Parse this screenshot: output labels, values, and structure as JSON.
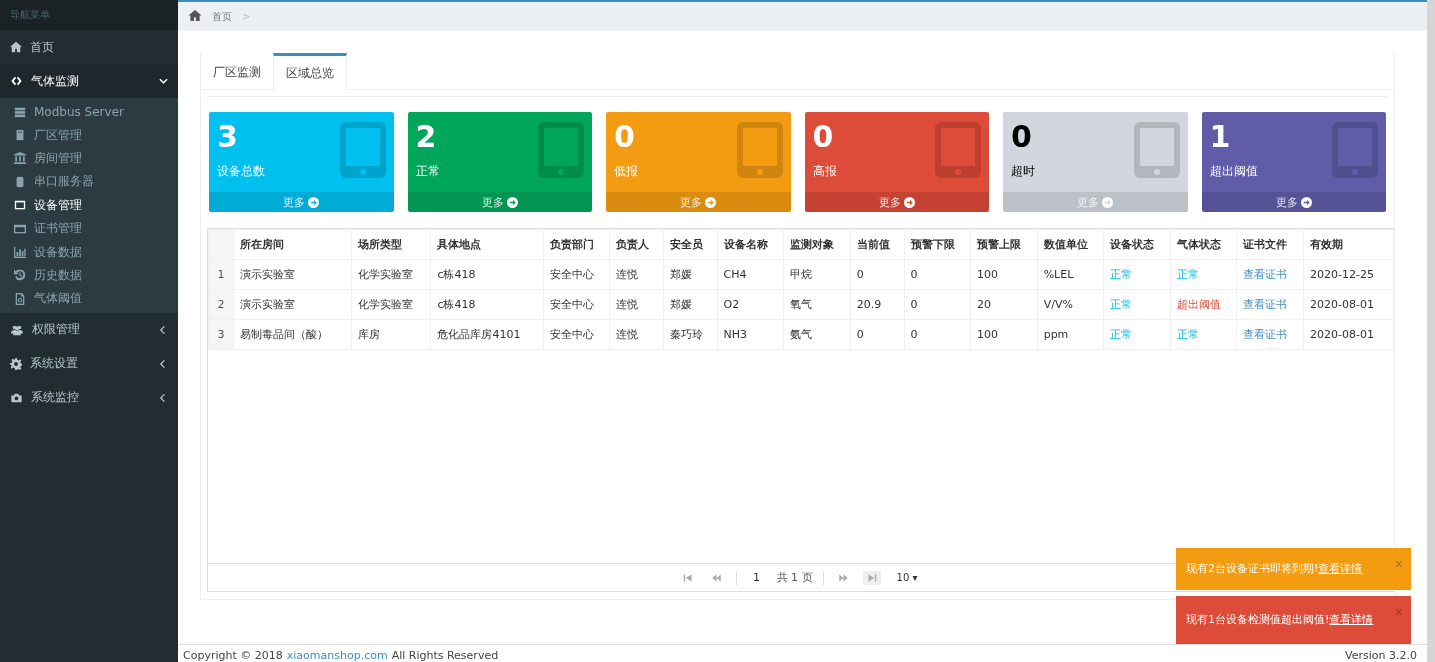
{
  "sidebar": {
    "header": "导航菜单",
    "items": [
      {
        "label": "首页"
      },
      {
        "label": "气体监测",
        "expanded": true,
        "children": [
          {
            "label": "Modbus Server",
            "selected": false
          },
          {
            "label": "厂区管理",
            "selected": false
          },
          {
            "label": "房间管理",
            "selected": false
          },
          {
            "label": "串口服务器",
            "selected": false
          },
          {
            "label": "设备管理",
            "selected": true
          },
          {
            "label": "证书管理",
            "selected": false
          },
          {
            "label": "设备数据",
            "selected": false
          },
          {
            "label": "历史数据",
            "selected": false
          },
          {
            "label": "气体阈值",
            "selected": false
          }
        ]
      },
      {
        "label": "权限管理",
        "expanded": false
      },
      {
        "label": "系统设置",
        "expanded": false
      },
      {
        "label": "系统监控",
        "expanded": false
      }
    ]
  },
  "breadcrumb": {
    "items": [
      "首页"
    ],
    "separator": ">"
  },
  "tabs": [
    {
      "label": "厂区监测",
      "selected": false
    },
    {
      "label": "区域总览",
      "selected": true
    }
  ],
  "cards": [
    {
      "count": "3",
      "label": "设备总数",
      "more": "更多",
      "color": "#00c0ef"
    },
    {
      "count": "2",
      "label": "正常",
      "more": "更多",
      "color": "#00a65a"
    },
    {
      "count": "0",
      "label": "低报",
      "more": "更多",
      "color": "#f39c12"
    },
    {
      "count": "0",
      "label": "高报",
      "more": "更多",
      "color": "#dd4b39"
    },
    {
      "count": "0",
      "label": "超时",
      "more": "更多",
      "color": "#d2d6de"
    },
    {
      "count": "1",
      "label": "超出阈值",
      "more": "更多",
      "color": "#605ca8"
    }
  ],
  "table": {
    "columns": [
      "所在房间",
      "场所类型",
      "具体地点",
      "负责部门",
      "负责人",
      "安全员",
      "设备名称",
      "监测对象",
      "当前值",
      "预警下限",
      "预警上限",
      "数值单位",
      "设备状态",
      "气体状态",
      "证书文件",
      "有效期"
    ],
    "rows": [
      {
        "index": "1",
        "cells": [
          {
            "text": "演示实验室",
            "kind": "text"
          },
          {
            "text": "化学实验室",
            "kind": "text"
          },
          {
            "text": "c栋418",
            "kind": "text"
          },
          {
            "text": "安全中心",
            "kind": "text"
          },
          {
            "text": "连悦",
            "kind": "text"
          },
          {
            "text": "郑媛",
            "kind": "text"
          },
          {
            "text": "CH4",
            "kind": "text"
          },
          {
            "text": "甲烷",
            "kind": "text"
          },
          {
            "text": "0",
            "kind": "text"
          },
          {
            "text": "0",
            "kind": "text"
          },
          {
            "text": "100",
            "kind": "text"
          },
          {
            "text": "%LEL",
            "kind": "text"
          },
          {
            "text": "正常",
            "kind": "ok"
          },
          {
            "text": "正常",
            "kind": "ok"
          },
          {
            "text": "查看证书",
            "kind": "link"
          },
          {
            "text": "2020-12-25",
            "kind": "text"
          }
        ]
      },
      {
        "index": "2",
        "cells": [
          {
            "text": "演示实验室",
            "kind": "text"
          },
          {
            "text": "化学实验室",
            "kind": "text"
          },
          {
            "text": "c栋418",
            "kind": "text"
          },
          {
            "text": "安全中心",
            "kind": "text"
          },
          {
            "text": "连悦",
            "kind": "text"
          },
          {
            "text": "郑媛",
            "kind": "text"
          },
          {
            "text": "O2",
            "kind": "text"
          },
          {
            "text": "氧气",
            "kind": "text"
          },
          {
            "text": "20.9",
            "kind": "text"
          },
          {
            "text": "0",
            "kind": "text"
          },
          {
            "text": "20",
            "kind": "text"
          },
          {
            "text": "V/V%",
            "kind": "text"
          },
          {
            "text": "正常",
            "kind": "ok"
          },
          {
            "text": "超出阈值",
            "kind": "alarm"
          },
          {
            "text": "查看证书",
            "kind": "link"
          },
          {
            "text": "2020-08-01",
            "kind": "text"
          }
        ]
      },
      {
        "index": "3",
        "cells": [
          {
            "text": "易制毒品间（酸）",
            "kind": "text"
          },
          {
            "text": "库房",
            "kind": "text"
          },
          {
            "text": "危化品库房4101",
            "kind": "text"
          },
          {
            "text": "安全中心",
            "kind": "text"
          },
          {
            "text": "连悦",
            "kind": "text"
          },
          {
            "text": "秦巧玲",
            "kind": "text"
          },
          {
            "text": "NH3",
            "kind": "text"
          },
          {
            "text": "氨气",
            "kind": "text"
          },
          {
            "text": "0",
            "kind": "text"
          },
          {
            "text": "0",
            "kind": "text"
          },
          {
            "text": "100",
            "kind": "text"
          },
          {
            "text": "ppm",
            "kind": "text"
          },
          {
            "text": "正常",
            "kind": "ok"
          },
          {
            "text": "正常",
            "kind": "ok"
          },
          {
            "text": "查看证书",
            "kind": "link"
          },
          {
            "text": "2020-08-01",
            "kind": "text"
          }
        ]
      }
    ]
  },
  "pager": {
    "page": "1",
    "total": "共 1 页",
    "page_size": "10 ▾"
  },
  "toasts": [
    {
      "kind": "warning",
      "text": "现有2台设备证书即将到期!",
      "link": "查看详情",
      "close": "×"
    },
    {
      "kind": "danger",
      "text": "现有1台设备检测值超出阈值!",
      "link": "查看详情",
      "close": "×"
    }
  ],
  "footer": {
    "copyright": "Copyright © 2018",
    "link": "xiaomanshop.com",
    "rights": "All Rights Reserved",
    "version": "Version 3.2.0"
  }
}
